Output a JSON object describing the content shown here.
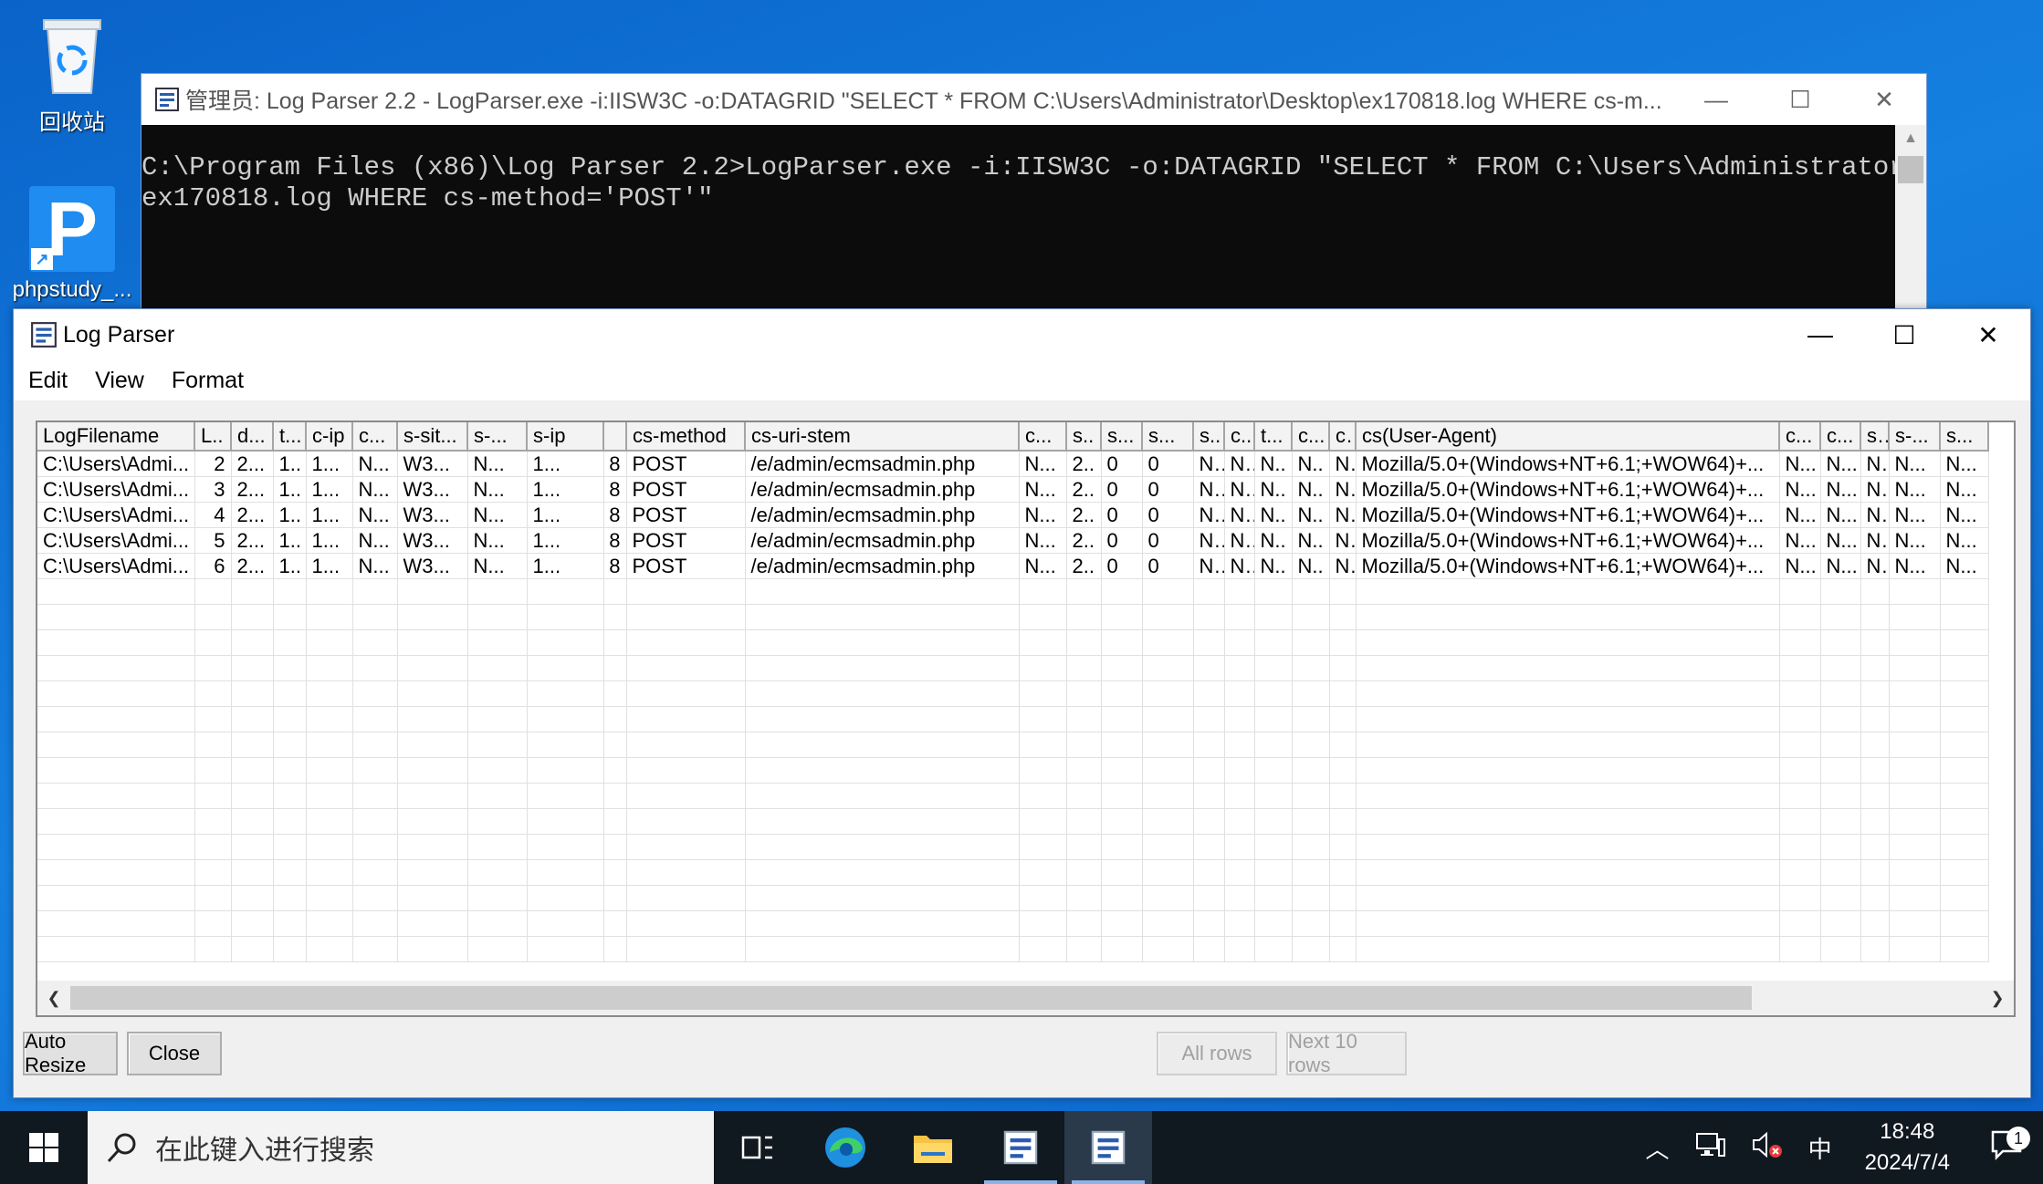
{
  "desktop": {
    "icons": [
      {
        "label": "回收站"
      },
      {
        "label": "phpstudy_..."
      }
    ]
  },
  "console": {
    "title": "管理员: Log Parser 2.2 - LogParser.exe  -i:IISW3C -o:DATAGRID \"SELECT * FROM C:\\Users\\Administrator\\Desktop\\ex170818.log WHERE cs-m...",
    "lines": [
      "C:\\Program Files (x86)\\Log Parser 2.2>LogParser.exe -i:IISW3C -o:DATAGRID \"SELECT * FROM C:\\Users\\Administrator\\Desktop\\",
      "ex170818.log WHERE cs-method='POST'\""
    ]
  },
  "logparser": {
    "title": "Log Parser",
    "menu": [
      "Edit",
      "View",
      "Format"
    ],
    "columns": [
      "LogFilename",
      "L..",
      "d...",
      "t...",
      "c-ip",
      "c...",
      "s-sit...",
      "s-...",
      "s-ip",
      "",
      "cs-method",
      "cs-uri-stem",
      "c...",
      "s..",
      "s...",
      "s...",
      "s..",
      "c..",
      "t...",
      "c...",
      "c..",
      "cs(User-Agent)",
      "c...",
      "c...",
      "s..",
      "s-...",
      "s..."
    ],
    "rows": [
      [
        "C:\\Users\\Admi...",
        "2",
        "2...",
        "1..",
        "1...",
        "N...",
        "W3...",
        "N...",
        "1...",
        "8",
        "POST",
        "/e/admin/ecmsadmin.php",
        "N...",
        "2..",
        "0",
        "0",
        "N..",
        "N..",
        "N..",
        "N..",
        "N..",
        "Mozilla/5.0+(Windows+NT+6.1;+WOW64)+...",
        "N...",
        "N...",
        "N..",
        "N...",
        "N..."
      ],
      [
        "C:\\Users\\Admi...",
        "3",
        "2...",
        "1..",
        "1...",
        "N...",
        "W3...",
        "N...",
        "1...",
        "8",
        "POST",
        "/e/admin/ecmsadmin.php",
        "N...",
        "2..",
        "0",
        "0",
        "N..",
        "N..",
        "N..",
        "N..",
        "N..",
        "Mozilla/5.0+(Windows+NT+6.1;+WOW64)+...",
        "N...",
        "N...",
        "N..",
        "N...",
        "N..."
      ],
      [
        "C:\\Users\\Admi...",
        "4",
        "2...",
        "1..",
        "1...",
        "N...",
        "W3...",
        "N...",
        "1...",
        "8",
        "POST",
        "/e/admin/ecmsadmin.php",
        "N...",
        "2..",
        "0",
        "0",
        "N..",
        "N..",
        "N..",
        "N..",
        "N..",
        "Mozilla/5.0+(Windows+NT+6.1;+WOW64)+...",
        "N...",
        "N...",
        "N..",
        "N...",
        "N..."
      ],
      [
        "C:\\Users\\Admi...",
        "5",
        "2...",
        "1..",
        "1...",
        "N...",
        "W3...",
        "N...",
        "1...",
        "8",
        "POST",
        "/e/admin/ecmsadmin.php",
        "N...",
        "2..",
        "0",
        "0",
        "N..",
        "N..",
        "N..",
        "N..",
        "N..",
        "Mozilla/5.0+(Windows+NT+6.1;+WOW64)+...",
        "N...",
        "N...",
        "N..",
        "N...",
        "N..."
      ],
      [
        "C:\\Users\\Admi...",
        "6",
        "2...",
        "1..",
        "1...",
        "N...",
        "W3...",
        "N...",
        "1...",
        "8",
        "POST",
        "/e/admin/ecmsadmin.php",
        "N...",
        "2..",
        "0",
        "0",
        "N..",
        "N..",
        "N..",
        "N..",
        "N..",
        "Mozilla/5.0+(Windows+NT+6.1;+WOW64)+...",
        "N...",
        "N...",
        "N..",
        "N...",
        "N..."
      ]
    ],
    "buttons": {
      "auto_resize": "Auto Resize",
      "close": "Close",
      "all_rows": "All rows",
      "next_rows": "Next 10 rows"
    }
  },
  "taskbar": {
    "search_placeholder": "在此键入进行搜索",
    "ime": "中",
    "time": "18:48",
    "date": "2024/7/4",
    "notification_count": "1"
  },
  "icons": [
    "recycle-bin-icon",
    "phpstudy-icon",
    "logparser-icon",
    "minimize-icon",
    "maximize-icon",
    "close-icon",
    "windows-start-icon",
    "search-icon",
    "task-view-icon",
    "edge-icon",
    "file-explorer-icon",
    "chevron-up-icon",
    "network-icon",
    "volume-muted-icon",
    "notification-icon"
  ]
}
